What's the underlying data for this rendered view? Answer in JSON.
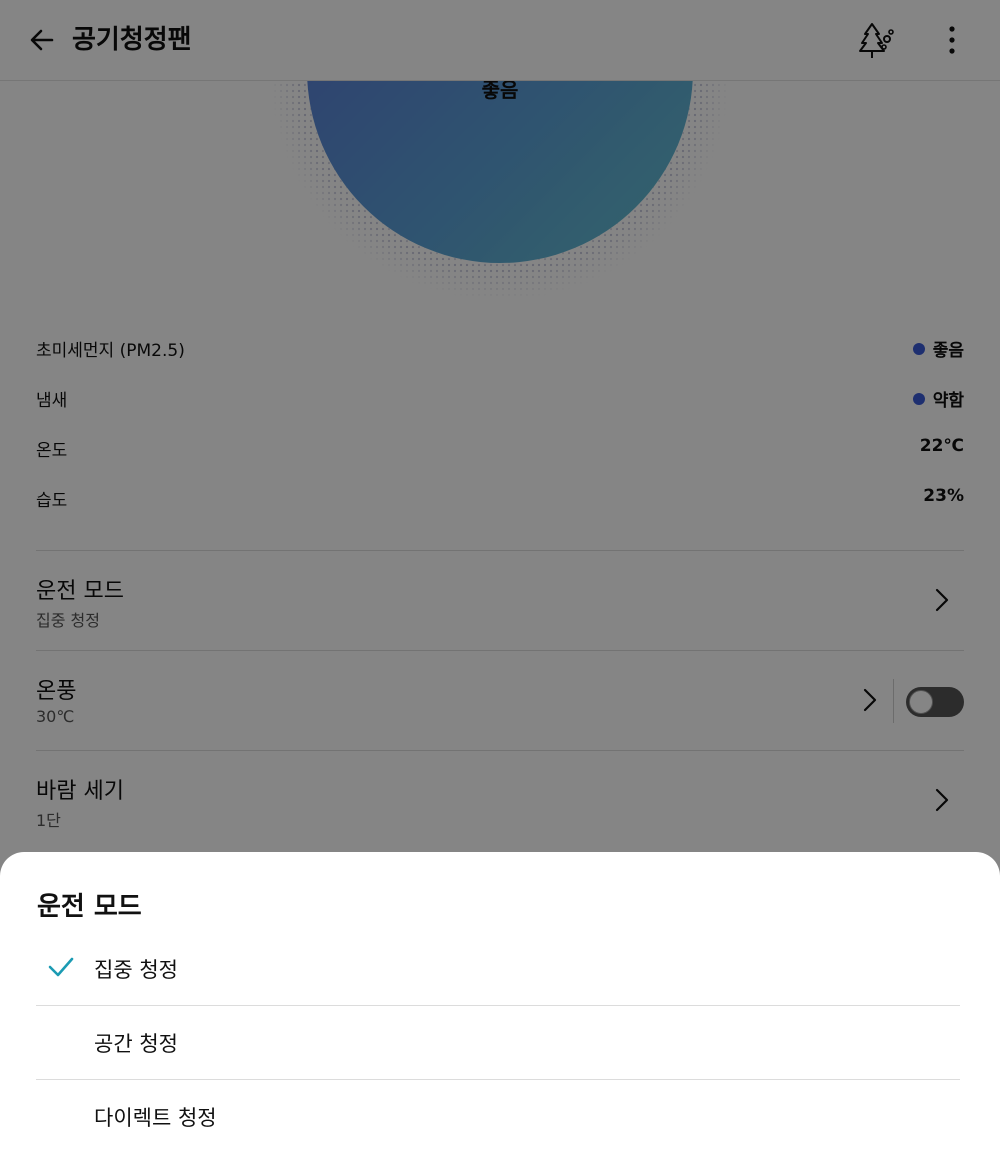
{
  "header": {
    "title": "공기청정팬",
    "back_icon": "arrow-left-icon",
    "tree_icon": "tree-icon",
    "more_icon": "more-vertical-icon"
  },
  "gauge": {
    "status": "좋음",
    "color": "#4a8fd8"
  },
  "info_rows": [
    {
      "label": "초미세먼지 (PM2.5)",
      "value": "좋음",
      "dot": true
    },
    {
      "label": "냄새",
      "value": "약함",
      "dot": true
    },
    {
      "label": "온도",
      "value": "22℃",
      "dot": false
    },
    {
      "label": "습도",
      "value": "23%",
      "dot": false
    }
  ],
  "settings": [
    {
      "name": "운전 모드",
      "sub": "집중 청정"
    },
    {
      "name": "온풍",
      "sub": "30℃",
      "toggle_on": false
    },
    {
      "name": "바람 세기",
      "sub": "1단"
    }
  ],
  "sheet": {
    "title": "운전 모드",
    "options": [
      {
        "label": "집중 청정",
        "selected": true
      },
      {
        "label": "공간 청정",
        "selected": false
      },
      {
        "label": "다이렉트 청정",
        "selected": false
      }
    ],
    "accent": "#1b9bb3"
  }
}
